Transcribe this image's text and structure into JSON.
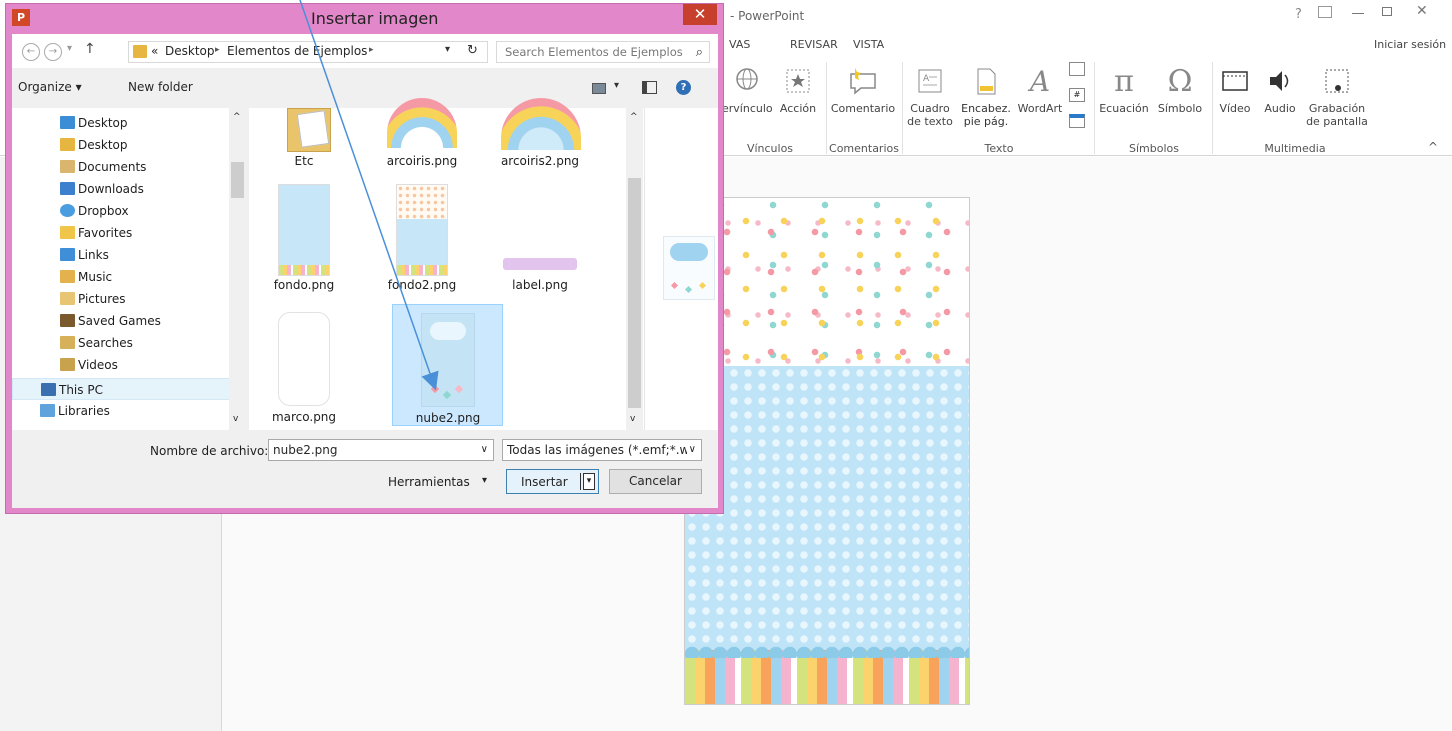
{
  "powerpoint": {
    "title_fragment": "- PowerPoint",
    "help": "?",
    "signin": "Iniciar sesión",
    "tabs": [
      "VAS",
      "REVISAR",
      "VISTA"
    ],
    "ribbon": {
      "hyperlink": "ervínculo",
      "action": "Acción",
      "comment": "Comentario",
      "textbox_1": "Cuadro",
      "textbox_2": "de texto",
      "header_1": "Encabez.",
      "header_2": "pie pág.",
      "wordart": "WordArt",
      "equation": "Ecuación",
      "symbol": "Símbolo",
      "video": "Vídeo",
      "audio": "Audio",
      "recording_1": "Grabación",
      "recording_2": "de pantalla",
      "groups": {
        "links": "Vínculos",
        "comments": "Comentarios",
        "text": "Texto",
        "symbols": "Símbolos",
        "media": "Multimedia"
      }
    }
  },
  "dialog": {
    "title": "Insertar imagen",
    "app_badge": "P",
    "close": "✕",
    "breadcrumb": {
      "prefix": "«",
      "items": [
        "Desktop",
        "Elementos de Ejemplos"
      ]
    },
    "search_placeholder": "Search Elementos de Ejemplos",
    "toolbar": {
      "organize": "Organize ▾",
      "new_folder": "New folder"
    },
    "sidebar": [
      {
        "label": "Desktop",
        "icon": "desktop-folder-icon"
      },
      {
        "label": "Desktop",
        "icon": "folder-icon"
      },
      {
        "label": "Documents",
        "icon": "documents-icon"
      },
      {
        "label": "Downloads",
        "icon": "downloads-icon"
      },
      {
        "label": "Dropbox",
        "icon": "dropbox-icon"
      },
      {
        "label": "Favorites",
        "icon": "favorites-icon"
      },
      {
        "label": "Links",
        "icon": "links-icon"
      },
      {
        "label": "Music",
        "icon": "music-icon"
      },
      {
        "label": "Pictures",
        "icon": "pictures-icon"
      },
      {
        "label": "Saved Games",
        "icon": "saved-games-icon"
      },
      {
        "label": "Searches",
        "icon": "searches-icon"
      },
      {
        "label": "Videos",
        "icon": "videos-icon"
      },
      {
        "label": "This PC",
        "icon": "pc-icon"
      },
      {
        "label": "Libraries",
        "icon": "libraries-icon"
      }
    ],
    "files": [
      {
        "name": "Etc"
      },
      {
        "name": "arcoiris.png"
      },
      {
        "name": "arcoiris2.png"
      },
      {
        "name": "fondo.png"
      },
      {
        "name": "fondo2.png"
      },
      {
        "name": "label.png"
      },
      {
        "name": "marco.png"
      },
      {
        "name": "nube2.png",
        "selected": true
      }
    ],
    "footer": {
      "filename_label": "Nombre de archivo:",
      "filename_value": "nube2.png",
      "filter_value": "Todas las imágenes (*.emf;*.wr",
      "tools": "Herramientas",
      "insert": "Insertar",
      "cancel": "Cancelar"
    }
  },
  "colors": {
    "dialog_frame": "#e287c9",
    "close_red": "#c7402d",
    "selection": "#cce8ff",
    "ppt_orange": "#d24726",
    "arrow": "#4a90d9"
  }
}
